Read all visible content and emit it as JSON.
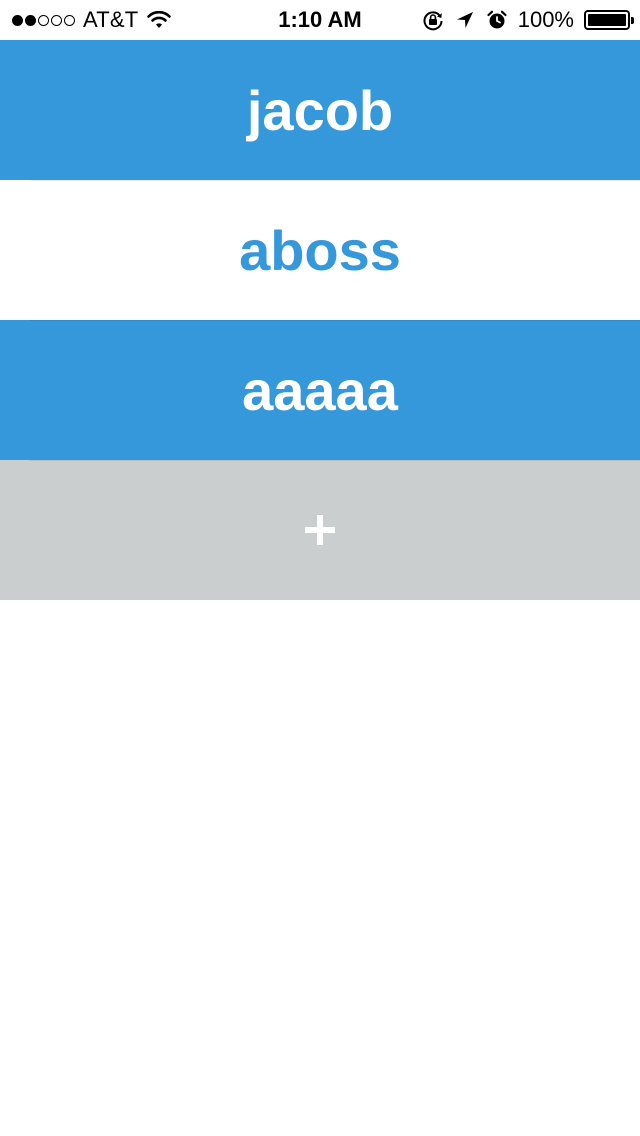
{
  "status_bar": {
    "carrier": "AT&T",
    "signal_bars_filled": 2,
    "signal_bars_total": 5,
    "time": "1:10 AM",
    "battery_percent": "100%",
    "icons": [
      "wifi-icon",
      "orientation-lock-icon",
      "location-arrow-icon",
      "alarm-clock-icon",
      "battery-icon"
    ]
  },
  "list": {
    "items": [
      {
        "label": "jacob"
      },
      {
        "label": "aboss"
      },
      {
        "label": "aaaaa"
      }
    ],
    "add_label": "+"
  },
  "colors": {
    "accent_blue": "#3598db",
    "add_row_gray": "#cacecf",
    "background": "#ffffff"
  }
}
